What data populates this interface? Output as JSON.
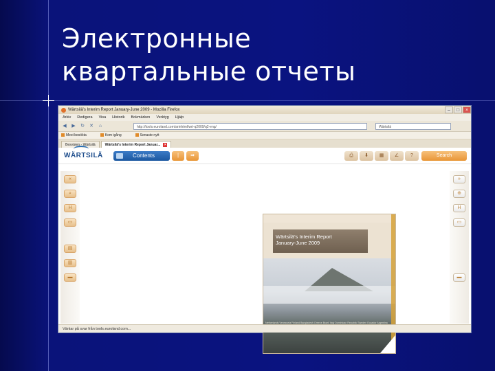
{
  "slide": {
    "title_line1": "Электронные",
    "title_line2": "квартальные отчеты"
  },
  "browser": {
    "window_title": "Wärtsilä's Interim Report January-June 2009 - Mozilla Firefox",
    "menu": [
      "Arkiv",
      "Redigera",
      "Visa",
      "Historik",
      "Bokmärken",
      "Verktyg",
      "Hjälp"
    ],
    "url": "http://tools.euroland.com/arinhtml/wrt-q2009/q2-eng/",
    "search_value": "Wärtsilä",
    "bookmarks": [
      "Mest besökta",
      "Kom igång",
      "Senaste nytt"
    ],
    "tabs": [
      "Besvären - Wärtsilä",
      "Wärtsilä's Interim Report Januar..."
    ],
    "status_text": "Väntar på svar från tools.euroland.com..."
  },
  "app": {
    "logo": "WÄRTSILÄ",
    "contents_label": "Contents",
    "search_label": "Search",
    "cover_title_line1": "Wärtsilä's Interim Report",
    "cover_title_line2": "January-June 2009",
    "cover_words": "Netherlands Venezuela Finland Bangladesh Greece Brazil Italy Dominican Republic Sweden Ecuador Argentina Mexico Crete Poland Wales Spain Germany China Peru Iceland Kenya Japan Panama Vietnam Egypt Turkey Malta Lebanon Russia Aruba Iceland Singapore India Bahrain"
  },
  "colors": {
    "slide_bg": "#0a1380",
    "accent_orange": "#e99536",
    "contents_blue": "#1b57a0"
  }
}
